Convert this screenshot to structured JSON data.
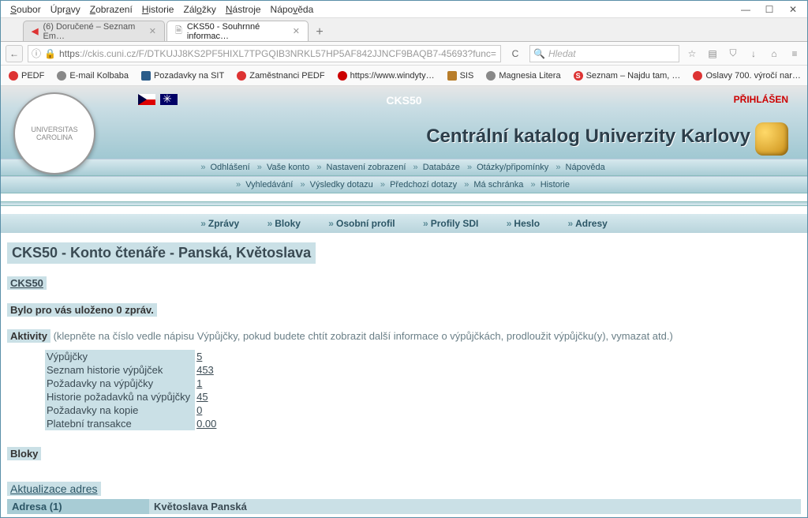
{
  "menubar": [
    "Soubor",
    "Úpravy",
    "Zobrazení",
    "Historie",
    "Záložky",
    "Nástroje",
    "Nápověda"
  ],
  "tabs": [
    {
      "label": "(6) Doručené – Seznam Em…",
      "active": false
    },
    {
      "label": "CKS50 - Souhrnné informac…",
      "active": true
    }
  ],
  "url": {
    "scheme": "https",
    "host": "://ckis.cuni.cz",
    "path": "/F/DTKUJJ8KS2PF5HIXL7TPGQIB3NRKL57HP5AF842JJNCF9BAQB7-45693?func="
  },
  "search_placeholder": "Hledat",
  "bookmarks": [
    {
      "label": "PEDF",
      "color": "#d33"
    },
    {
      "label": "E-mail Kolbaba",
      "color": "#888"
    },
    {
      "label": "Pozadavky na SIT",
      "color": "#2a5c8a"
    },
    {
      "label": "Zaměstnanci PEDF",
      "color": "#d33"
    },
    {
      "label": "https://www.windyty…",
      "color": "#c00"
    },
    {
      "label": "SIS",
      "color": "#b87d2a"
    },
    {
      "label": "Magnesia Litera",
      "color": "#888"
    },
    {
      "label": "Seznam – Najdu tam, …",
      "color": "#d33"
    },
    {
      "label": "Oslavy 700. výročí nar…",
      "color": "#d33"
    }
  ],
  "header": {
    "code": "CKS50",
    "login": "PŘIHLÁŠEN",
    "title": "Centrální katalog Univerzity  Karlovy"
  },
  "nav1": [
    "Odhlášení",
    "Vaše konto",
    "Nastavení zobrazení",
    "Databáze",
    "Otázky/připomínky",
    "Nápověda"
  ],
  "nav2": [
    "Vyhledávání",
    "Výsledky dotazu",
    "Předchozí dotazy",
    "Má schránka",
    "Historie"
  ],
  "subnav": [
    "Zprávy",
    "Bloky",
    "Osobní profil",
    "Profily SDI",
    "Heslo",
    "Adresy"
  ],
  "page_h": "CKS50 - Konto čtenáře - Panská, Květoslava",
  "lib": "CKS50",
  "messages": "Bylo pro vás uloženo 0 zpráv.",
  "activities": {
    "head_bold": "Aktivity",
    "head_rest": "(klepněte na číslo vedle nápisu Výpůjčky, pokud budete chtít zobrazit další informace o výpůjčkách, prodloužit výpůjčku(y), vymazat atd.)",
    "rows": [
      {
        "label": "Výpůjčky",
        "value": "5"
      },
      {
        "label": "Seznam historie výpůjček",
        "value": "453"
      },
      {
        "label": "Požadavky na výpůjčky",
        "value": "1"
      },
      {
        "label": "Historie požadavků na výpůjčky",
        "value": "45"
      },
      {
        "label": "Požadavky na kopie",
        "value": "0"
      },
      {
        "label": "Platební transakce",
        "value": "0.00"
      }
    ]
  },
  "blocks": "Bloky",
  "addr_link": "Aktualizace adres",
  "addr": {
    "a": "Adresa (1)",
    "b": "Květoslava Panská"
  }
}
